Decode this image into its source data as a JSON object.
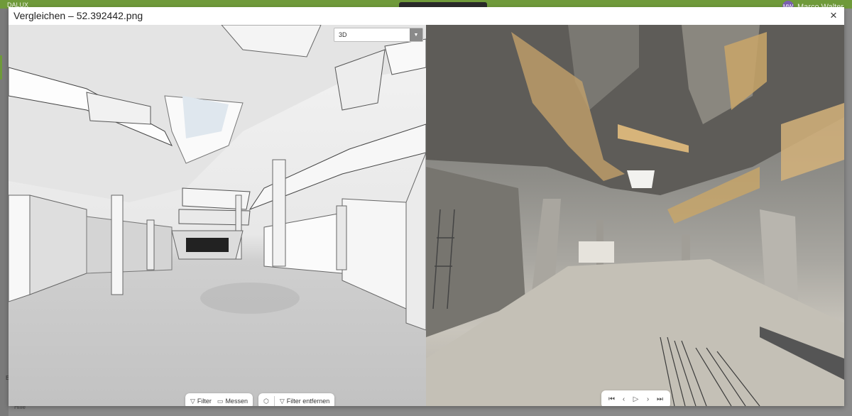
{
  "app": {
    "brand": "DALUX",
    "user_initials": "MW",
    "user_name": "Marco Walter",
    "help_label": "Hilfe",
    "side_letter": "E"
  },
  "dialog": {
    "title": "Vergleichen – 52.392442.png",
    "close_icon": "×"
  },
  "view_select": {
    "value": "3D",
    "options": [
      "3D"
    ]
  },
  "left_toolbar": {
    "filter_label": "Filter",
    "measure_label": "Messen"
  },
  "right_toolbar": {
    "remove_filter_label": "Filter entfernen"
  },
  "player": {
    "first_icon": "⏮",
    "prev_icon": "‹",
    "play_icon": "▷",
    "next_icon": "›",
    "last_icon": "⏭"
  },
  "colors": {
    "brand_green": "#6f9a3a",
    "avatar": "#7b5fb0"
  }
}
